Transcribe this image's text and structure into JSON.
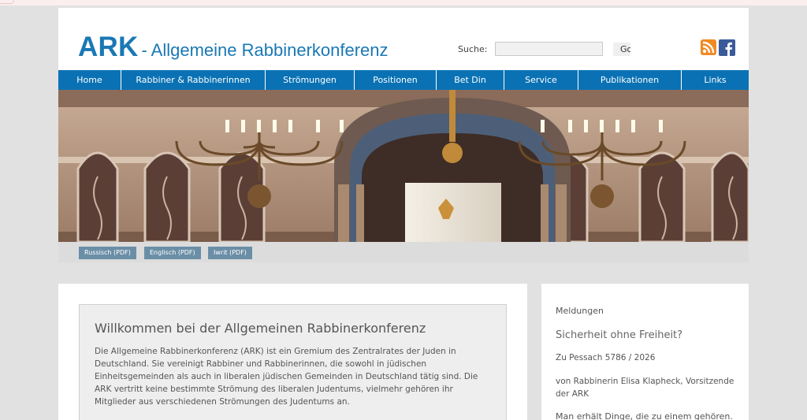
{
  "header": {
    "logo_main": "ARK",
    "logo_sub": "- Allgemeine Rabbinerkonferenz",
    "search_label": "Suche:",
    "search_value": "",
    "search_button": "Go",
    "icons": [
      "rss-icon",
      "facebook-icon"
    ]
  },
  "nav": {
    "items": [
      {
        "label": "Home"
      },
      {
        "label": "Rabbiner & Rabbinerinnen"
      },
      {
        "label": "Strömungen"
      },
      {
        "label": "Positionen"
      },
      {
        "label": "Bet Din"
      },
      {
        "label": "Service"
      },
      {
        "label": "Publikationen"
      },
      {
        "label": "Links"
      }
    ]
  },
  "language_buttons": [
    {
      "label": "Russisch (PDF)"
    },
    {
      "label": "Englisch (PDF)"
    },
    {
      "label": "Iwrit (PDF)"
    }
  ],
  "welcome": {
    "title": "Willkommen bei der Allgemeinen Rabbinerkonferenz",
    "text": "Die Allgemeine Rabbinerkonferenz (ARK) ist ein Gremium des Zentralrates der Juden in Deutschland. Sie vereinigt Rabbiner und Rabbinerinnen, die sowohl in jüdischen Einheitsgemeinden als auch in liberalen jüdischen Gemeinden in Deutschland tätig sind. Die ARK vertritt keine bestimmte Strömung des liberalen Judentums, vielmehr gehören ihr Mitglieder aus verschiedenen Strömungen des Judentums an."
  },
  "sidebar": {
    "heading": "Meldungen",
    "news_title": "Sicherheit ohne Freiheit?",
    "line1": "Zu Pessach 5786 / 2026",
    "line2": "von Rabbinerin Elisa Klapheck, Vorsitzende der ARK",
    "line3": "Man erhält Dinge, die zu einem gehören."
  },
  "colors": {
    "brand_blue": "#1a78b4",
    "nav_blue": "#0a72b4",
    "lang_button": "#6b8ea7",
    "page_bg": "#e1e1e1"
  }
}
